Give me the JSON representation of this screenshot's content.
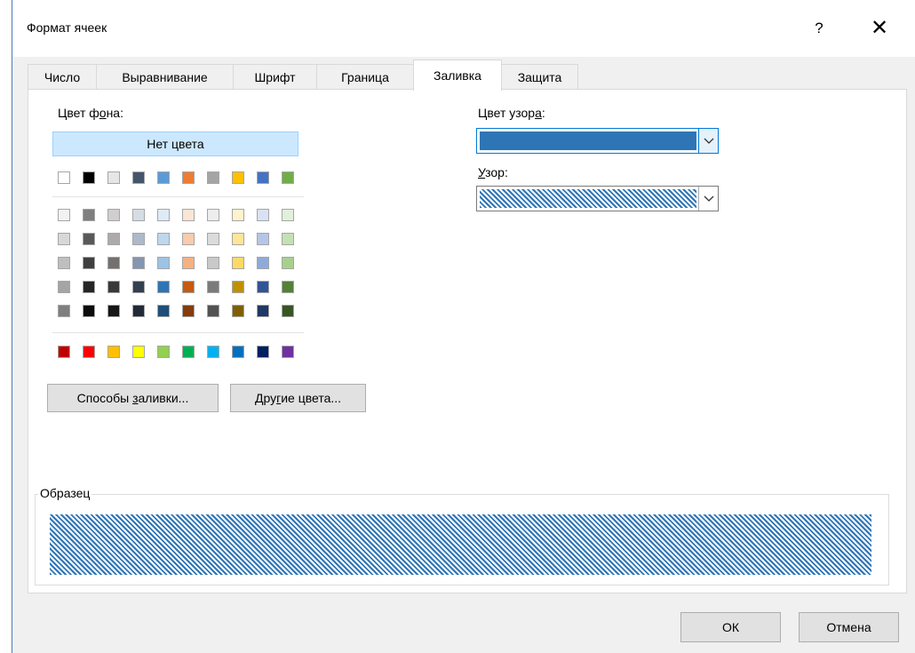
{
  "window": {
    "title": "Формат ячеек",
    "help": "?",
    "close": "✕"
  },
  "tabs": [
    {
      "label": "Число"
    },
    {
      "label": "Выравнивание"
    },
    {
      "label": "Шрифт"
    },
    {
      "label": "Граница"
    },
    {
      "label": "Заливка",
      "active": true
    },
    {
      "label": "Защита"
    }
  ],
  "fill": {
    "background_label_pre": "Цвет ф",
    "background_label_u": "о",
    "background_label_post": "на:",
    "no_color": "Нет цвета",
    "theme_top_row": [
      "#ffffff",
      "#000000",
      "#e7e6e6",
      "#44546a",
      "#5b9bd5",
      "#ed7d31",
      "#a5a5a5",
      "#ffc000",
      "#4472c4",
      "#70ad47"
    ],
    "theme_shades": [
      [
        "#f2f2f2",
        "#7f7f7f",
        "#d0cece",
        "#d6dce4",
        "#deebf6",
        "#fbe5d5",
        "#ededed",
        "#fff2cc",
        "#d9e2f3",
        "#e2efd9"
      ],
      [
        "#d8d8d8",
        "#595959",
        "#aeaaaa",
        "#adb9ca",
        "#bdd7ee",
        "#f7cbac",
        "#dbdbdb",
        "#fee599",
        "#b4c6e7",
        "#c5e0b3"
      ],
      [
        "#bfbfbf",
        "#3f3f3f",
        "#757070",
        "#8496b0",
        "#9cc3e5",
        "#f4b183",
        "#c9c9c9",
        "#ffd966",
        "#8eaadb",
        "#a8d08d"
      ],
      [
        "#a5a5a5",
        "#262626",
        "#3a3838",
        "#323f4f",
        "#2e75b5",
        "#c55a11",
        "#7b7b7b",
        "#bf9000",
        "#2f5496",
        "#538135"
      ],
      [
        "#7f7f7f",
        "#0c0c0c",
        "#171616",
        "#222a35",
        "#1e4e79",
        "#833c0b",
        "#525252",
        "#7f6000",
        "#1f3864",
        "#375623"
      ]
    ],
    "standard_colors": [
      "#c00000",
      "#ff0000",
      "#ffc000",
      "#ffff00",
      "#92d050",
      "#00b050",
      "#00b0f0",
      "#0070c0",
      "#002060",
      "#7030a0"
    ],
    "fill_effects_pre": "Способы ",
    "fill_effects_u": "з",
    "fill_effects_post": "аливки...",
    "more_colors_pre": "Дру",
    "more_colors_u": "г",
    "more_colors_post": "ие цвета...",
    "pattern_color_label_pre": "Цвет узор",
    "pattern_color_label_u": "а",
    "pattern_color_label_post": ":",
    "pattern_color_value": "#2e75b6",
    "pattern_label_u": "У",
    "pattern_label_post": "зор:",
    "pattern_value_icon": "diagonal-stripe-pattern",
    "sample_label": "Образец"
  },
  "footer": {
    "ok": "ОК",
    "cancel": "Отмена"
  }
}
